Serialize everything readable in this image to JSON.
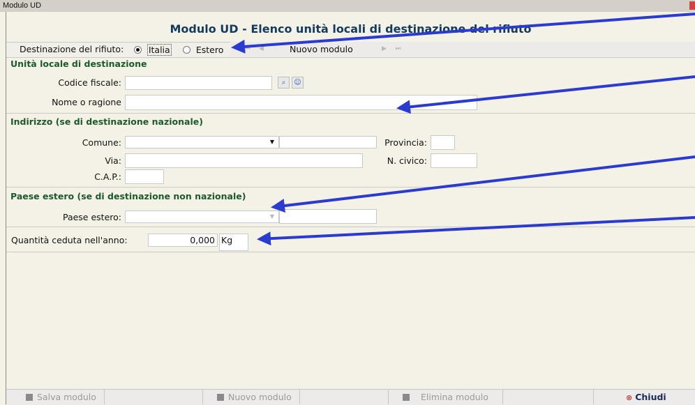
{
  "window": {
    "title": "Modulo UD"
  },
  "header": {
    "title": "Modulo UD - Elenco unità locali di destinazione del rifiuto"
  },
  "toolbar": {
    "destinazione_label": "Destinazione del rifiuto:",
    "radio_italia": "Italia",
    "radio_estero": "Estero",
    "nav_new_label": "Nuovo modulo"
  },
  "sections": {
    "unita_locale": "Unità locale di destinazione",
    "indirizzo": "Indirizzo (se di destinazione nazionale)",
    "paese_estero": "Paese estero (se di destinazione non nazionale)"
  },
  "labels": {
    "codice_fiscale": "Codice fiscale:",
    "nome_ragione": "Nome o ragione",
    "comune": "Comune:",
    "provincia": "Provincia:",
    "via": "Via:",
    "n_civico": "N. civico:",
    "cap": "C.A.P.:",
    "paese_estero": "Paese estero:",
    "quantita": "Quantità ceduta nell'anno:"
  },
  "values": {
    "quantita": "0,000",
    "unit": "Kg"
  },
  "bottom": {
    "salva": "Salva modulo",
    "nuovo": "Nuovo modulo",
    "elimina": "Elimina modulo",
    "chiudi": "Chiudi"
  },
  "icons": {
    "search_icon": "⌕",
    "person_icon": "☺",
    "dropdown_icon": "▼",
    "first_icon": "⏮",
    "prev_icon": "◀",
    "next_icon": "▶",
    "last_icon": "⏭",
    "close_icon": "⊗"
  },
  "colors": {
    "accent_header": "#133a5f",
    "section_title": "#1b5a2a",
    "arrow": "#2b3bd1",
    "chiudi": "#c24141"
  }
}
